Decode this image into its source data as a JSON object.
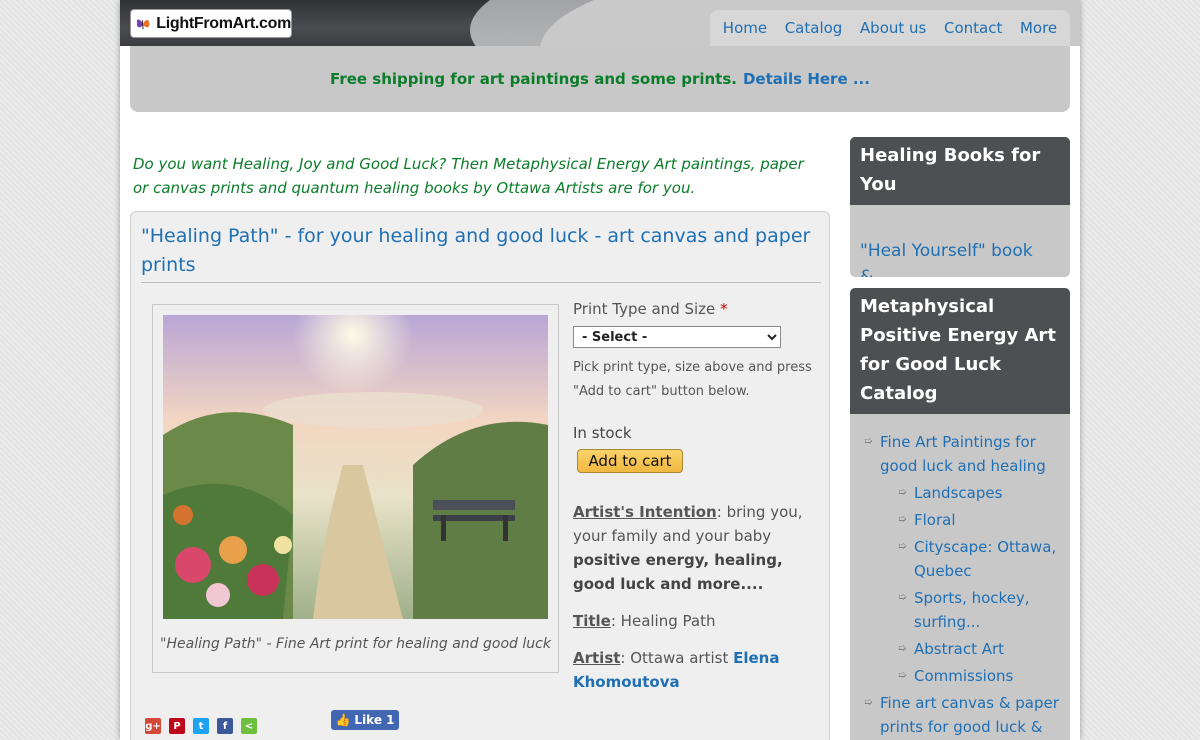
{
  "header": {
    "logo_text": "LightFromArt.com",
    "nav": [
      "Home",
      "Catalog",
      "About us",
      "Contact",
      "More"
    ]
  },
  "banner": {
    "text": "Free shipping for art paintings and some prints.",
    "link": "Details Here ..."
  },
  "intro": "Do you want Healing, Joy and Good Luck? Then Metaphysical Energy Art paintings, paper or canvas prints and quantum healing books by Ottawa Artists are for you.",
  "product": {
    "title": "\"Healing Path\" - for your healing and good luck - art canvas and paper prints",
    "caption": "\"Healing Path\" - Fine Art print for healing and good luck",
    "print_type_label": "Print Type and Size",
    "required_mark": "*",
    "select_value": "- Select -",
    "hint": "Pick print type, size above and press \"Add to cart\" button below.",
    "stock": "In stock",
    "add_to_cart": "Add to cart",
    "intention_key": "Artist's Intention",
    "intention_text": ": bring you, your family and your baby ",
    "intention_bold": "positive energy, healing, good luck and more....",
    "title_key": "Title",
    "title_value": ": Healing Path",
    "artist_key": "Artist",
    "artist_text": ": Ottawa artist ",
    "artist_link": "Elena Khomoutova",
    "like_label": "Like 1"
  },
  "sidebar": {
    "books_head": "Healing Books for You",
    "books_link": "\"Heal Yourself\" book &...",
    "catalog_head": "Metaphysical Positive Energy Art for Good Luck Catalog",
    "catalog": {
      "item1": "Fine Art Paintings for good luck and healing",
      "sub": [
        "Landscapes",
        "Floral",
        "Cityscape: Ottawa, Quebec",
        "Sports, hockey, surfing...",
        "Abstract Art",
        "Commissions"
      ],
      "item2": "Fine art canvas & paper prints for good luck & healing"
    }
  },
  "colors": {
    "link": "#1f6fb5",
    "green": "#0b7d2a",
    "header": "#4d4f52",
    "cart_button": "#f0b840"
  }
}
